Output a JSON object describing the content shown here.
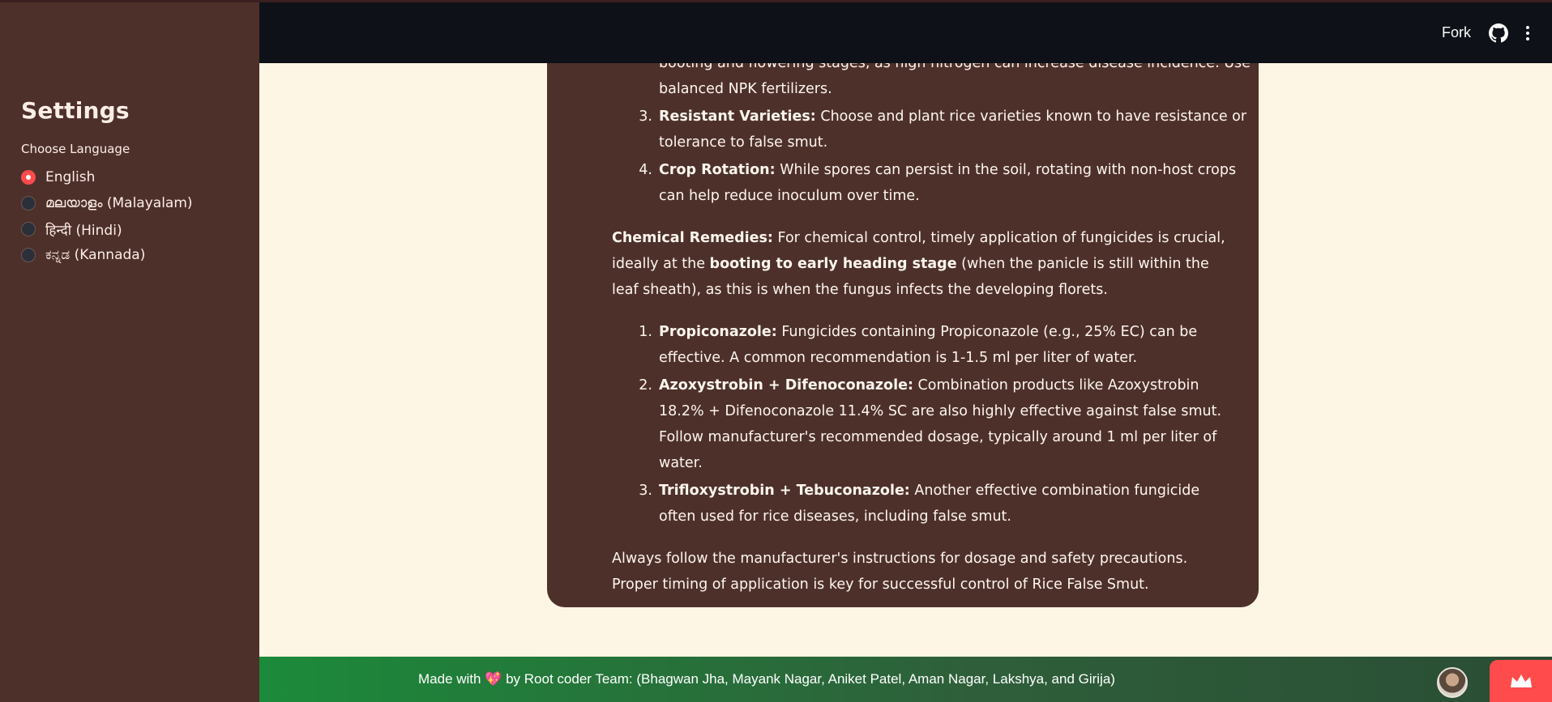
{
  "header": {
    "fork_label": "Fork",
    "github_icon": "github-icon",
    "menu_icon": "kebab-menu-icon"
  },
  "sidebar": {
    "title": "Settings",
    "language_label": "Choose Language",
    "options": [
      {
        "label": "English",
        "selected": true
      },
      {
        "label": "മലയാളം (Malayalam)",
        "selected": false
      },
      {
        "label": "हिन्दी (Hindi)",
        "selected": false
      },
      {
        "label": "ಕನ್ನಡ (Kannada)",
        "selected": false
      }
    ]
  },
  "content": {
    "cut_line_1": "booting and flowering stages, as high nitrogen can increase disease incidence. Use",
    "cut_line_2": "balanced NPK fertilizers.",
    "cultural_items": [
      {
        "num": "3.",
        "bold": "Resistant Varieties:",
        "text": " Choose and plant rice varieties known to have resistance or tolerance to false smut."
      },
      {
        "num": "4.",
        "bold": "Crop Rotation:",
        "text": " While spores can persist in the soil, rotating with non-host crops can help reduce inoculum over time."
      }
    ],
    "chemical_heading": "Chemical Remedies:",
    "chemical_intro_1": " For chemical control, timely application of fungicides is crucial, ideally at the ",
    "chemical_intro_bold": "booting to early heading stage",
    "chemical_intro_2": " (when the panicle is still within the leaf sheath), as this is when the fungus infects the developing florets.",
    "chemical_items": [
      {
        "num": "1.",
        "bold": "Propiconazole:",
        "text": " Fungicides containing Propiconazole (e.g., 25% EC) can be effective. A common recommendation is 1-1.5 ml per liter of water."
      },
      {
        "num": "2.",
        "bold": "Azoxystrobin + Difenoconazole:",
        "text": " Combination products like Azoxystrobin 18.2% + Difenoconazole 11.4% SC are also highly effective against false smut. Follow manufacturer's recommended dosage, typically around 1 ml per liter of water."
      },
      {
        "num": "3.",
        "bold": "Trifloxystrobin + Tebuconazole:",
        "text": " Another effective combination fungicide often used for rice diseases, including false smut."
      }
    ],
    "closing": "Always follow the manufacturer's instructions for dosage and safety precautions. Proper timing of application is key for successful control of Rice False Smut."
  },
  "footer": {
    "text_before": "Made with ",
    "heart": "💖",
    "text_after": " by Root coder Team: (Bhagwan Jha, Mayank Nagar, Aniket Patel, Aman Nagar, Lakshya, and Girija)",
    "crown_icon": "crown-icon"
  },
  "colors": {
    "sidebar": "#4e302b",
    "card": "#4e302b",
    "header": "#0e1117",
    "accent": "#ff4b4b",
    "page": "#fef6e4"
  }
}
